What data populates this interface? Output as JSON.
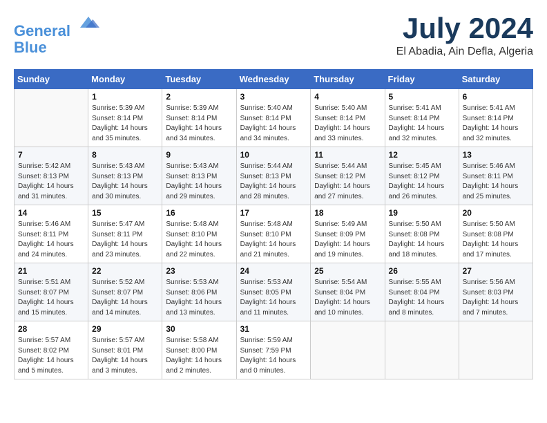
{
  "logo": {
    "line1": "General",
    "line2": "Blue"
  },
  "title": "July 2024",
  "location": "El Abadia, Ain Defla, Algeria",
  "weekdays": [
    "Sunday",
    "Monday",
    "Tuesday",
    "Wednesday",
    "Thursday",
    "Friday",
    "Saturday"
  ],
  "weeks": [
    [
      {
        "day": "",
        "info": ""
      },
      {
        "day": "1",
        "info": "Sunrise: 5:39 AM\nSunset: 8:14 PM\nDaylight: 14 hours\nand 35 minutes."
      },
      {
        "day": "2",
        "info": "Sunrise: 5:39 AM\nSunset: 8:14 PM\nDaylight: 14 hours\nand 34 minutes."
      },
      {
        "day": "3",
        "info": "Sunrise: 5:40 AM\nSunset: 8:14 PM\nDaylight: 14 hours\nand 34 minutes."
      },
      {
        "day": "4",
        "info": "Sunrise: 5:40 AM\nSunset: 8:14 PM\nDaylight: 14 hours\nand 33 minutes."
      },
      {
        "day": "5",
        "info": "Sunrise: 5:41 AM\nSunset: 8:14 PM\nDaylight: 14 hours\nand 32 minutes."
      },
      {
        "day": "6",
        "info": "Sunrise: 5:41 AM\nSunset: 8:14 PM\nDaylight: 14 hours\nand 32 minutes."
      }
    ],
    [
      {
        "day": "7",
        "info": "Sunrise: 5:42 AM\nSunset: 8:13 PM\nDaylight: 14 hours\nand 31 minutes."
      },
      {
        "day": "8",
        "info": "Sunrise: 5:43 AM\nSunset: 8:13 PM\nDaylight: 14 hours\nand 30 minutes."
      },
      {
        "day": "9",
        "info": "Sunrise: 5:43 AM\nSunset: 8:13 PM\nDaylight: 14 hours\nand 29 minutes."
      },
      {
        "day": "10",
        "info": "Sunrise: 5:44 AM\nSunset: 8:13 PM\nDaylight: 14 hours\nand 28 minutes."
      },
      {
        "day": "11",
        "info": "Sunrise: 5:44 AM\nSunset: 8:12 PM\nDaylight: 14 hours\nand 27 minutes."
      },
      {
        "day": "12",
        "info": "Sunrise: 5:45 AM\nSunset: 8:12 PM\nDaylight: 14 hours\nand 26 minutes."
      },
      {
        "day": "13",
        "info": "Sunrise: 5:46 AM\nSunset: 8:11 PM\nDaylight: 14 hours\nand 25 minutes."
      }
    ],
    [
      {
        "day": "14",
        "info": "Sunrise: 5:46 AM\nSunset: 8:11 PM\nDaylight: 14 hours\nand 24 minutes."
      },
      {
        "day": "15",
        "info": "Sunrise: 5:47 AM\nSunset: 8:11 PM\nDaylight: 14 hours\nand 23 minutes."
      },
      {
        "day": "16",
        "info": "Sunrise: 5:48 AM\nSunset: 8:10 PM\nDaylight: 14 hours\nand 22 minutes."
      },
      {
        "day": "17",
        "info": "Sunrise: 5:48 AM\nSunset: 8:10 PM\nDaylight: 14 hours\nand 21 minutes."
      },
      {
        "day": "18",
        "info": "Sunrise: 5:49 AM\nSunset: 8:09 PM\nDaylight: 14 hours\nand 19 minutes."
      },
      {
        "day": "19",
        "info": "Sunrise: 5:50 AM\nSunset: 8:08 PM\nDaylight: 14 hours\nand 18 minutes."
      },
      {
        "day": "20",
        "info": "Sunrise: 5:50 AM\nSunset: 8:08 PM\nDaylight: 14 hours\nand 17 minutes."
      }
    ],
    [
      {
        "day": "21",
        "info": "Sunrise: 5:51 AM\nSunset: 8:07 PM\nDaylight: 14 hours\nand 15 minutes."
      },
      {
        "day": "22",
        "info": "Sunrise: 5:52 AM\nSunset: 8:07 PM\nDaylight: 14 hours\nand 14 minutes."
      },
      {
        "day": "23",
        "info": "Sunrise: 5:53 AM\nSunset: 8:06 PM\nDaylight: 14 hours\nand 13 minutes."
      },
      {
        "day": "24",
        "info": "Sunrise: 5:53 AM\nSunset: 8:05 PM\nDaylight: 14 hours\nand 11 minutes."
      },
      {
        "day": "25",
        "info": "Sunrise: 5:54 AM\nSunset: 8:04 PM\nDaylight: 14 hours\nand 10 minutes."
      },
      {
        "day": "26",
        "info": "Sunrise: 5:55 AM\nSunset: 8:04 PM\nDaylight: 14 hours\nand 8 minutes."
      },
      {
        "day": "27",
        "info": "Sunrise: 5:56 AM\nSunset: 8:03 PM\nDaylight: 14 hours\nand 7 minutes."
      }
    ],
    [
      {
        "day": "28",
        "info": "Sunrise: 5:57 AM\nSunset: 8:02 PM\nDaylight: 14 hours\nand 5 minutes."
      },
      {
        "day": "29",
        "info": "Sunrise: 5:57 AM\nSunset: 8:01 PM\nDaylight: 14 hours\nand 3 minutes."
      },
      {
        "day": "30",
        "info": "Sunrise: 5:58 AM\nSunset: 8:00 PM\nDaylight: 14 hours\nand 2 minutes."
      },
      {
        "day": "31",
        "info": "Sunrise: 5:59 AM\nSunset: 7:59 PM\nDaylight: 14 hours\nand 0 minutes."
      },
      {
        "day": "",
        "info": ""
      },
      {
        "day": "",
        "info": ""
      },
      {
        "day": "",
        "info": ""
      }
    ]
  ]
}
